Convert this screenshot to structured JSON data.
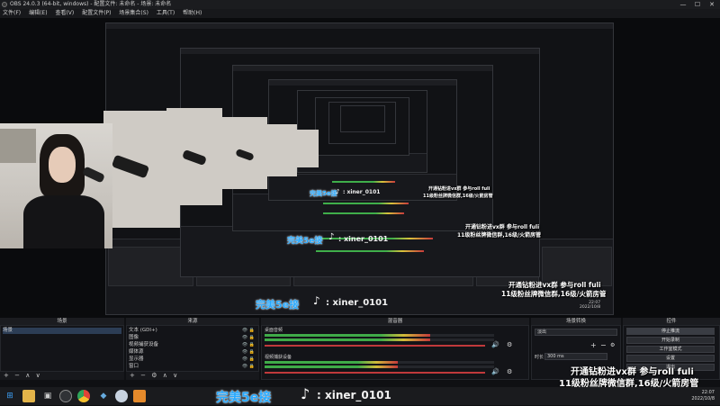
{
  "window": {
    "title": "OBS 24.0.3 (64-bit, windows) - 配置文件: 未命名 - 场景: 未命名",
    "minimize": "—",
    "maximize": "☐",
    "close": "✕"
  },
  "menu": [
    "文件(F)",
    "编辑(E)",
    "查看(V)",
    "配置文件(P)",
    "场景集合(S)",
    "工具(T)",
    "帮助(H)"
  ],
  "overlay": {
    "brand": "完美5e接",
    "tiktok_icon": "♪",
    "tiktok_handle": ": xiner_0101",
    "promo_line1": "开通钻粉进vx群 参与roll fuli",
    "promo_line2": "11级粉丝牌微信群,16级/火箭房管",
    "nested_time": "22:07",
    "nested_date": "2022/10/8"
  },
  "dock": {
    "scenes": {
      "header": "场景",
      "items": [
        "场景"
      ],
      "footer": [
        "+",
        "−",
        "∧",
        "∨"
      ]
    },
    "sources": {
      "header": "来源",
      "items": [
        {
          "label": "文本 (GDI+)"
        },
        {
          "label": "图像"
        },
        {
          "label": "视频捕获设备"
        },
        {
          "label": "媒体源"
        },
        {
          "label": "显示器"
        },
        {
          "label": "窗口"
        }
      ],
      "footer": [
        "+",
        "−",
        "⚙",
        "∧",
        "∨"
      ]
    },
    "mixer": {
      "header": "混音器",
      "channels": [
        {
          "name": "桌面音频",
          "level": 0.72
        },
        {
          "name": "视频捕获设备",
          "level": 0.58
        }
      ]
    },
    "transitions": {
      "header": "场景转换",
      "selected": "淡出",
      "duration_label": "时长",
      "duration_value": "300 ms"
    },
    "controls": {
      "header": "控件",
      "buttons": [
        "停止推流",
        "开始录制",
        "工作室模式",
        "设置",
        "退出"
      ]
    }
  },
  "taskbar": {
    "time": "22:07",
    "date": "2022/10/8"
  }
}
